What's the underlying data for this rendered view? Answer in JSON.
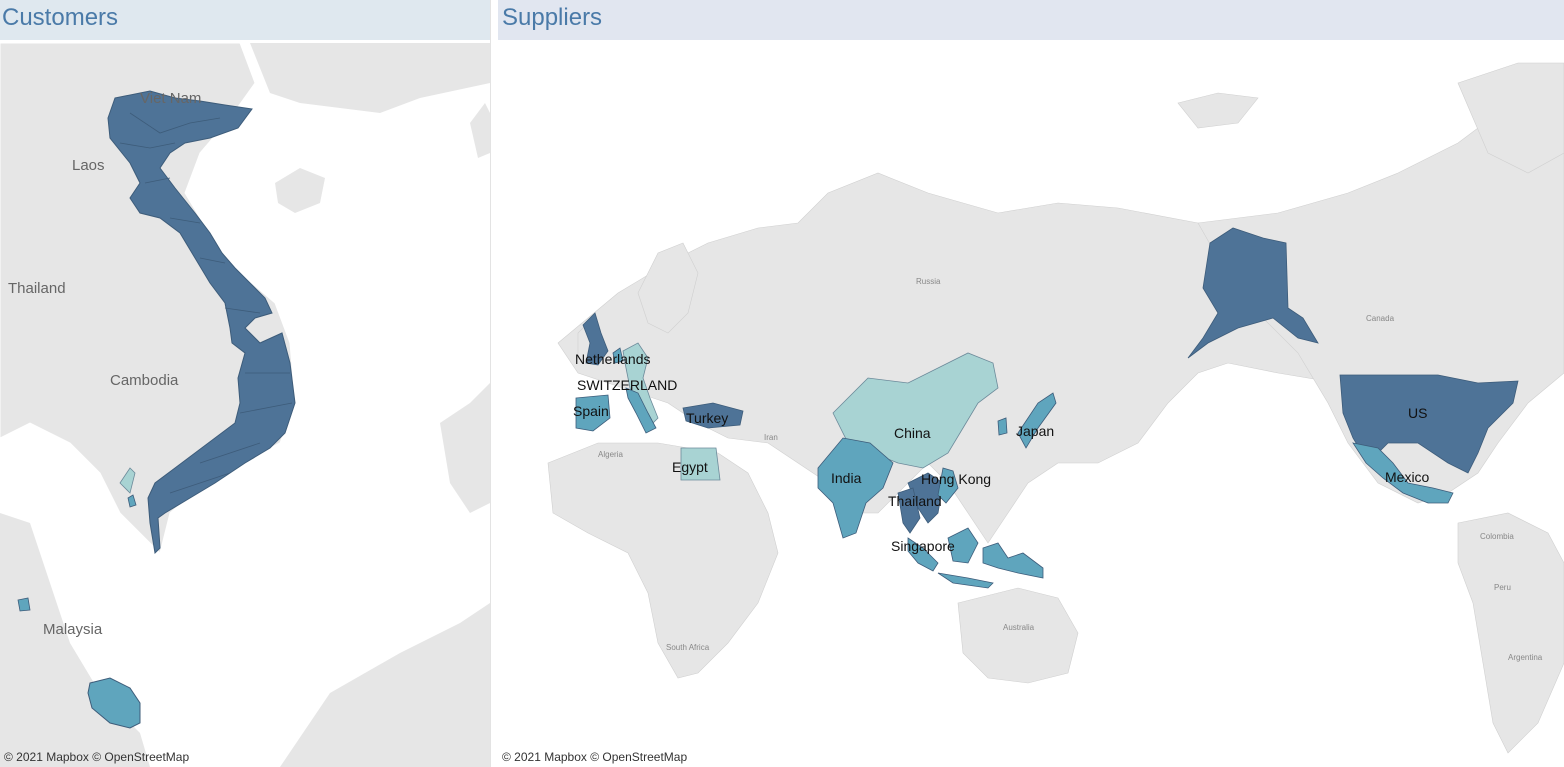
{
  "customers": {
    "title": "Customers",
    "map_credit": "© 2021 Mapbox © OpenStreetMap",
    "base_labels": [
      "Laos",
      "Thailand",
      "Cambodia",
      "Malaysia",
      "Viet Nam"
    ]
  },
  "suppliers": {
    "title": "Suppliers",
    "map_credit": "© 2021 Mapbox © OpenStreetMap",
    "country_labels": [
      "Netherlands",
      "SWITZERLAND",
      "Spain",
      "Turkey",
      "Egypt",
      "China",
      "Japan",
      "India",
      "Hong Kong",
      "Thailand",
      "Singapore",
      "US",
      "Mexico"
    ],
    "base_labels": [
      "Russia",
      "Canada",
      "Algeria",
      "Iran",
      "Australia",
      "South Africa",
      "Colombia",
      "Peru",
      "Argentina"
    ]
  },
  "colors": {
    "high": "#4e7397",
    "mid": "#5fa5bd",
    "low": "#a8d3d3",
    "land": "#e6e6e6",
    "water": "#ffffff",
    "title": "#4a7aa8"
  }
}
